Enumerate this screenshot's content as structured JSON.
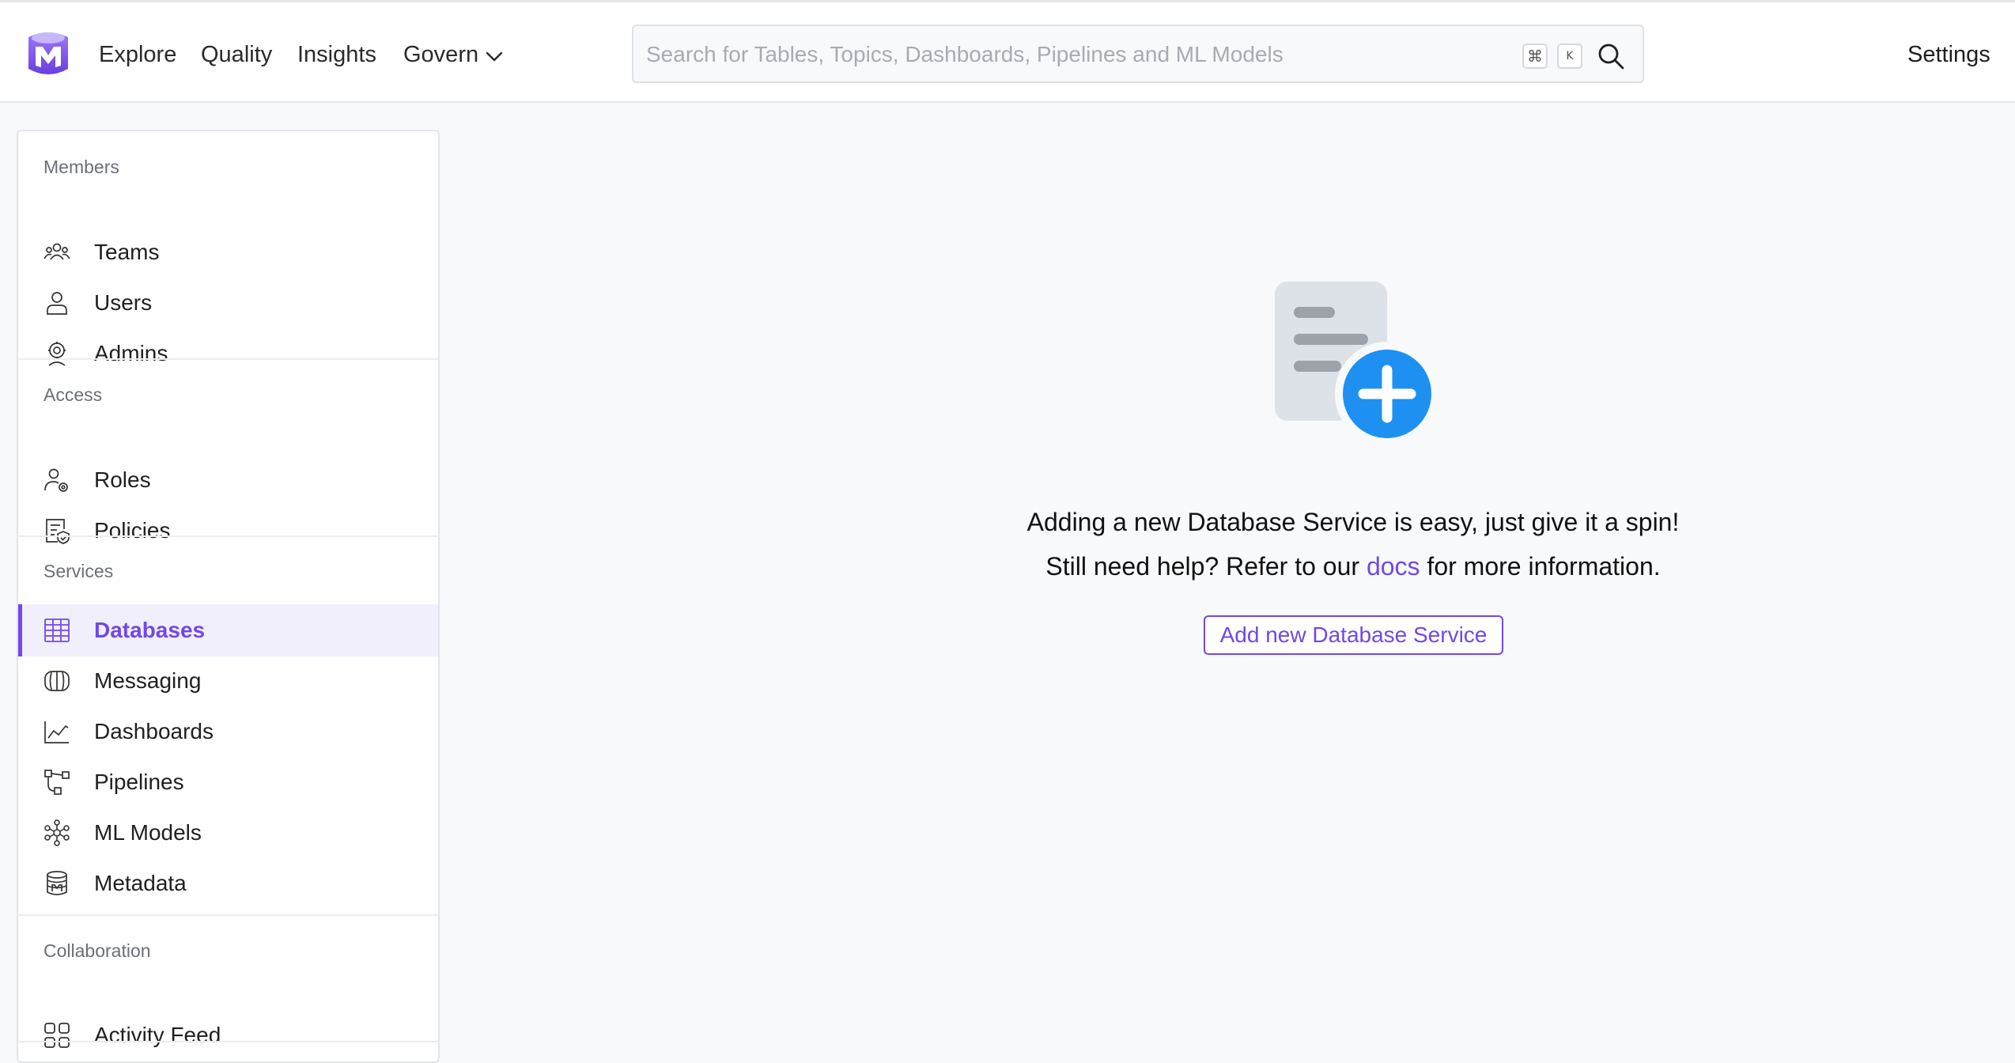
{
  "colors": {
    "accent": "#7147e8",
    "active_bg": "#f2effd",
    "plus_badge": "#1e90f2",
    "page_bg": "#f8f9fb"
  },
  "navbar": {
    "logo_icon": "openmetadata-logo-icon",
    "links": {
      "explore": "Explore",
      "quality": "Quality",
      "insights": "Insights",
      "govern": "Govern"
    },
    "govern_icon": "chevron-down-icon",
    "search": {
      "placeholder": "Search for Tables, Topics, Dashboards, Pipelines and ML Models",
      "value": "",
      "shortcut_cmd": "⌘",
      "shortcut_key": "K",
      "icon": "search-icon"
    },
    "settings": "Settings"
  },
  "sidebar": {
    "sections": {
      "members": {
        "title": "Members",
        "items": [
          {
            "label": "Teams",
            "icon": "teams-icon"
          },
          {
            "label": "Users",
            "icon": "user-icon"
          },
          {
            "label": "Admins",
            "icon": "admin-icon"
          }
        ]
      },
      "access": {
        "title": "Access",
        "items": [
          {
            "label": "Roles",
            "icon": "roles-icon"
          },
          {
            "label": "Policies",
            "icon": "policies-icon"
          }
        ]
      },
      "services": {
        "title": "Services",
        "items": [
          {
            "label": "Databases",
            "icon": "database-table-icon",
            "active": true
          },
          {
            "label": "Messaging",
            "icon": "messaging-icon"
          },
          {
            "label": "Dashboards",
            "icon": "dashboard-chart-icon"
          },
          {
            "label": "Pipelines",
            "icon": "pipeline-icon"
          },
          {
            "label": "ML Models",
            "icon": "ml-model-icon"
          },
          {
            "label": "Metadata",
            "icon": "metadata-icon"
          }
        ]
      },
      "collaboration": {
        "title": "Collaboration",
        "items": [
          {
            "label": "Activity Feed",
            "icon": "activity-feed-icon"
          }
        ]
      }
    }
  },
  "main": {
    "illustration_icon": "add-document-icon",
    "message_line1": "Adding a new Database Service is easy, just give it a spin!",
    "message_line2_before": "Still need help? Refer to our",
    "message_link": "docs",
    "message_line2_after": "for more information.",
    "add_button": "Add new Database Service"
  }
}
